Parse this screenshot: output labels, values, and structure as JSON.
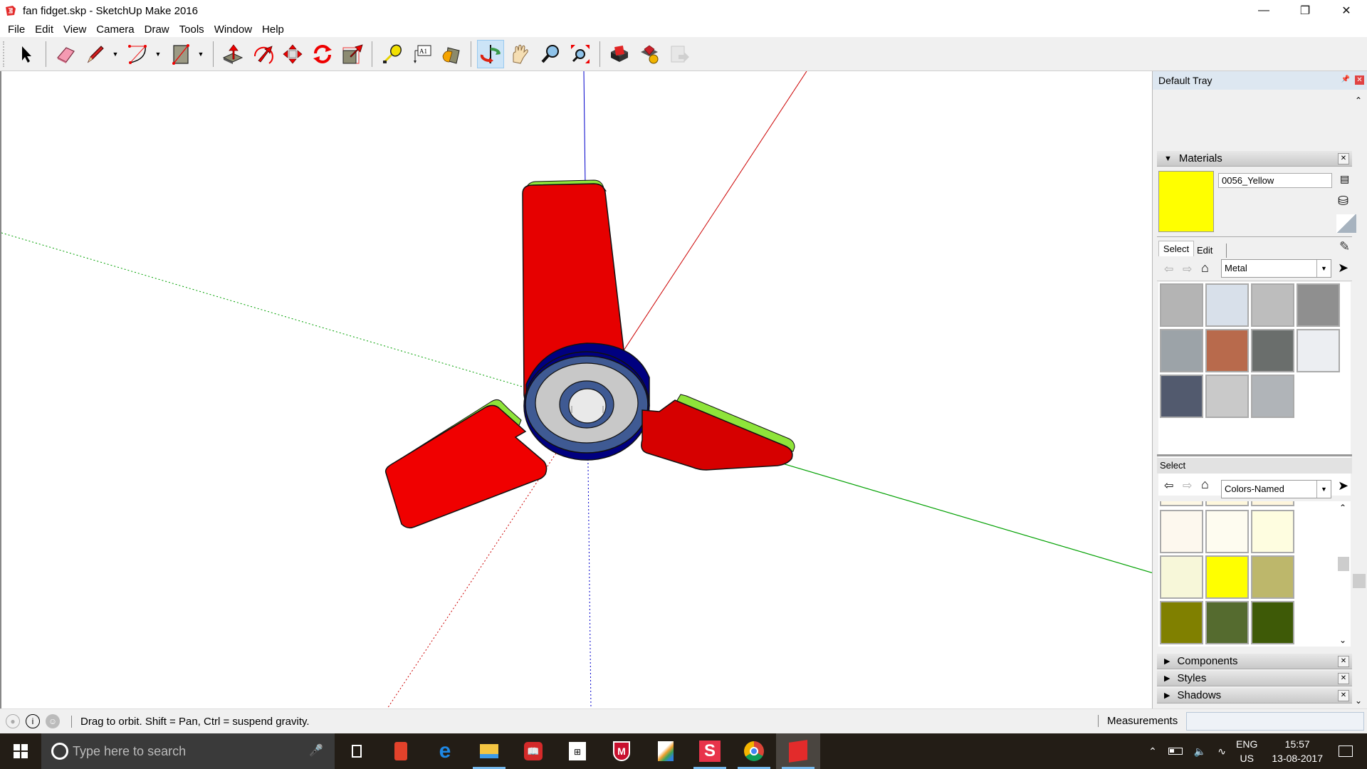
{
  "window": {
    "title": "fan fidget.skp - SketchUp Make 2016",
    "controls": [
      "minimize",
      "restore",
      "close"
    ]
  },
  "menu": [
    "File",
    "Edit",
    "View",
    "Camera",
    "Draw",
    "Tools",
    "Window",
    "Help"
  ],
  "toolbar": {
    "tools": [
      {
        "name": "select-tool",
        "label": "Select"
      },
      {
        "name": "eraser-tool",
        "label": "Eraser"
      },
      {
        "name": "line-tool",
        "label": "Line",
        "dropdown": true
      },
      {
        "name": "arc-tool",
        "label": "Arc",
        "dropdown": true
      },
      {
        "name": "rectangle-tool",
        "label": "Rectangle",
        "dropdown": true
      },
      {
        "name": "push-pull-tool",
        "label": "Push/Pull"
      },
      {
        "name": "follow-me-tool",
        "label": "Follow Me"
      },
      {
        "name": "move-tool",
        "label": "Move"
      },
      {
        "name": "rotate-tool",
        "label": "Rotate"
      },
      {
        "name": "scale-tool",
        "label": "Scale"
      },
      {
        "name": "tape-measure-tool",
        "label": "Tape Measure"
      },
      {
        "name": "text-tool",
        "label": "Text",
        "glyph": "A1"
      },
      {
        "name": "paint-bucket-tool",
        "label": "Paint Bucket"
      },
      {
        "name": "orbit-tool",
        "label": "Orbit",
        "active": true
      },
      {
        "name": "pan-tool",
        "label": "Pan"
      },
      {
        "name": "zoom-tool",
        "label": "Zoom"
      },
      {
        "name": "zoom-extents-tool",
        "label": "Zoom Extents"
      },
      {
        "name": "warehouse-tool",
        "label": "3D Warehouse"
      },
      {
        "name": "extension-warehouse-tool",
        "label": "Extension Warehouse"
      },
      {
        "name": "layout-tool",
        "label": "Send to LayOut",
        "disabled": true
      }
    ]
  },
  "model": {
    "blade_color": "#e60000",
    "blade_edge_color": "#8ee43a",
    "hub_color": "#000080",
    "bearing_ring_color": "#3f5a93",
    "bearing_face_color": "#c8c8c8",
    "axis_colors": {
      "red": "#cc0000",
      "green": "#00a000",
      "blue": "#0000cc"
    }
  },
  "tray": {
    "title": "Default Tray",
    "materials": {
      "title": "Materials",
      "current_name": "0056_Yellow",
      "current_color": "#ffff00",
      "tabs": [
        "Select",
        "Edit"
      ],
      "active_tab": "Select",
      "library": "Metal",
      "library_swatches": [
        "#b4b4b4",
        "#d8e0ea",
        "#bdbdbd",
        "#8f8f8f",
        "#9ca3a8",
        "#b86a4c",
        "#6a6e6c",
        "#eceef2",
        "#525a6e",
        "#c9c9c9",
        "#b0b4b8"
      ],
      "secondary_label": "Select",
      "secondary_library": "Colors-Named",
      "color_swatches": [
        "#fdf8ee",
        "#fefcf0",
        "#fefde0",
        "#f7f7d9",
        "#ffff00",
        "#bdb76b",
        "#808000",
        "#556b2f",
        "#3e5a07"
      ],
      "partial_row": [
        "#6b8e23",
        "#9acd32",
        "#adff2f"
      ]
    },
    "collapsed_panels": [
      "Components",
      "Styles",
      "Shadows"
    ]
  },
  "status": {
    "hint": "Drag to orbit. Shift = Pan, Ctrl = suspend gravity.",
    "measurements_label": "Measurements",
    "measurements_value": ""
  },
  "taskbar": {
    "search_placeholder": "Type here to search",
    "apps": [
      "cortana-app",
      "task-view",
      "app-red",
      "edge",
      "file-explorer",
      "reader",
      "store",
      "mcafee",
      "paint-app",
      "app-s",
      "chrome",
      "sketchup"
    ],
    "language": "ENG",
    "region": "US",
    "time": "15:57",
    "date": "13-08-2017"
  }
}
